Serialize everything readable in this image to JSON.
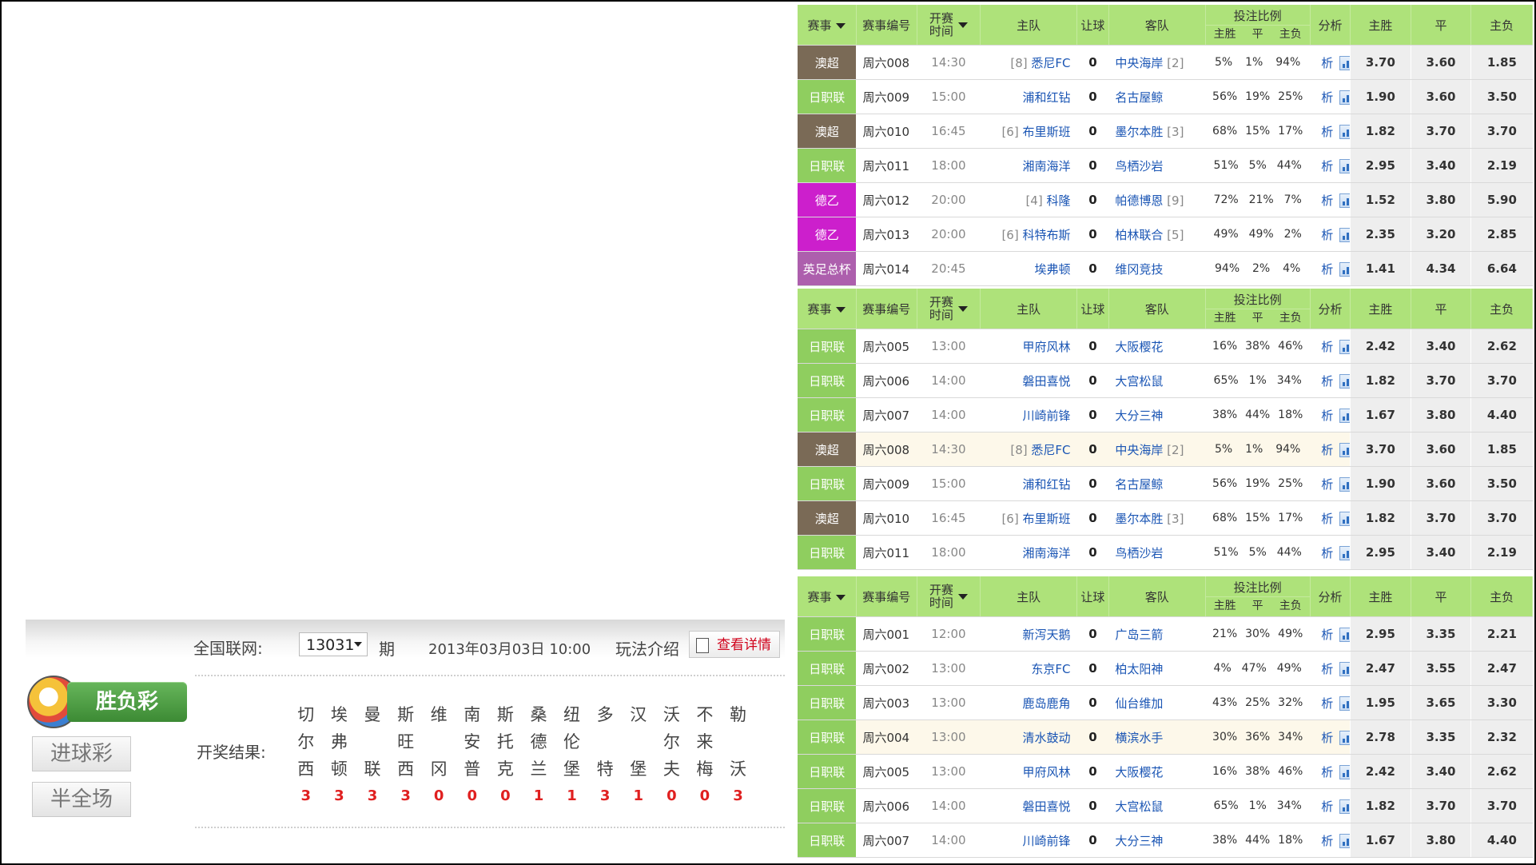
{
  "table_headers": {
    "league": "赛事",
    "match_no": "赛事编号",
    "kickoff_top": "开赛",
    "kickoff_bottom": "时间",
    "home": "主队",
    "handicap": "让球",
    "away": "客队",
    "ratio": "投注比例",
    "ratio_home": "主胜",
    "ratio_draw": "平",
    "ratio_away": "主负",
    "analysis": "分析",
    "odds_home": "主胜",
    "odds_draw": "平",
    "odds_away": "主负"
  },
  "colors": {
    "澳超": "#7a6a56",
    "日职联": "#8fce5f",
    "德乙": "#cc1fcc",
    "英足总杯": "#ad5fad"
  },
  "analysis_label": "析",
  "tables": [
    {
      "rows": [
        {
          "league": "澳超",
          "no": "周六008",
          "time": "14:30",
          "home_rank": "[8]",
          "home": "悉尼FC",
          "handicap": "0",
          "away": "中央海岸",
          "away_rank": "[2]",
          "r1": "5%",
          "r2": "1%",
          "r3": "94%",
          "o1": "3.70",
          "o2": "3.60",
          "o3": "1.85"
        },
        {
          "league": "日职联",
          "no": "周六009",
          "time": "15:00",
          "home_rank": "",
          "home": "浦和红钻",
          "handicap": "0",
          "away": "名古屋鲸",
          "away_rank": "",
          "r1": "56%",
          "r2": "19%",
          "r3": "25%",
          "o1": "1.90",
          "o2": "3.60",
          "o3": "3.50"
        },
        {
          "league": "澳超",
          "no": "周六010",
          "time": "16:45",
          "home_rank": "[6]",
          "home": "布里斯班",
          "handicap": "0",
          "away": "墨尔本胜",
          "away_rank": "[3]",
          "r1": "68%",
          "r2": "15%",
          "r3": "17%",
          "o1": "1.82",
          "o2": "3.70",
          "o3": "3.70"
        },
        {
          "league": "日职联",
          "no": "周六011",
          "time": "18:00",
          "home_rank": "",
          "home": "湘南海洋",
          "handicap": "0",
          "away": "鸟栖沙岩",
          "away_rank": "",
          "r1": "51%",
          "r2": "5%",
          "r3": "44%",
          "o1": "2.95",
          "o2": "3.40",
          "o3": "2.19"
        },
        {
          "league": "德乙",
          "no": "周六012",
          "time": "20:00",
          "home_rank": "[4]",
          "home": "科隆",
          "handicap": "0",
          "away": "帕德博恩",
          "away_rank": "[9]",
          "r1": "72%",
          "r2": "21%",
          "r3": "7%",
          "o1": "1.52",
          "o2": "3.80",
          "o3": "5.90"
        },
        {
          "league": "德乙",
          "no": "周六013",
          "time": "20:00",
          "home_rank": "[6]",
          "home": "科特布斯",
          "handicap": "0",
          "away": "柏林联合",
          "away_rank": "[5]",
          "r1": "49%",
          "r2": "49%",
          "r3": "2%",
          "o1": "2.35",
          "o2": "3.20",
          "o3": "2.85"
        },
        {
          "league": "英足总杯",
          "no": "周六014",
          "time": "20:45",
          "home_rank": "",
          "home": "埃弗顿",
          "handicap": "0",
          "away": "维冈竞技",
          "away_rank": "",
          "r1": "94%",
          "r2": "2%",
          "r3": "4%",
          "o1": "1.41",
          "o2": "4.34",
          "o3": "6.64"
        }
      ]
    },
    {
      "rows": [
        {
          "league": "日职联",
          "no": "周六005",
          "time": "13:00",
          "home_rank": "",
          "home": "甲府风林",
          "handicap": "0",
          "away": "大阪樱花",
          "away_rank": "",
          "r1": "16%",
          "r2": "38%",
          "r3": "46%",
          "o1": "2.42",
          "o2": "3.40",
          "o3": "2.62"
        },
        {
          "league": "日职联",
          "no": "周六006",
          "time": "14:00",
          "home_rank": "",
          "home": "磐田喜悦",
          "handicap": "0",
          "away": "大宫松鼠",
          "away_rank": "",
          "r1": "65%",
          "r2": "1%",
          "r3": "34%",
          "o1": "1.82",
          "o2": "3.70",
          "o3": "3.70"
        },
        {
          "league": "日职联",
          "no": "周六007",
          "time": "14:00",
          "home_rank": "",
          "home": "川崎前锋",
          "handicap": "0",
          "away": "大分三神",
          "away_rank": "",
          "r1": "38%",
          "r2": "44%",
          "r3": "18%",
          "o1": "1.67",
          "o2": "3.80",
          "o3": "4.40"
        },
        {
          "league": "澳超",
          "no": "周六008",
          "time": "14:30",
          "home_rank": "[8]",
          "home": "悉尼FC",
          "handicap": "0",
          "away": "中央海岸",
          "away_rank": "[2]",
          "r1": "5%",
          "r2": "1%",
          "r3": "94%",
          "o1": "3.70",
          "o2": "3.60",
          "o3": "1.85",
          "hl": true
        },
        {
          "league": "日职联",
          "no": "周六009",
          "time": "15:00",
          "home_rank": "",
          "home": "浦和红钻",
          "handicap": "0",
          "away": "名古屋鲸",
          "away_rank": "",
          "r1": "56%",
          "r2": "19%",
          "r3": "25%",
          "o1": "1.90",
          "o2": "3.60",
          "o3": "3.50"
        },
        {
          "league": "澳超",
          "no": "周六010",
          "time": "16:45",
          "home_rank": "[6]",
          "home": "布里斯班",
          "handicap": "0",
          "away": "墨尔本胜",
          "away_rank": "[3]",
          "r1": "68%",
          "r2": "15%",
          "r3": "17%",
          "o1": "1.82",
          "o2": "3.70",
          "o3": "3.70"
        },
        {
          "league": "日职联",
          "no": "周六011",
          "time": "18:00",
          "home_rank": "",
          "home": "湘南海洋",
          "handicap": "0",
          "away": "鸟栖沙岩",
          "away_rank": "",
          "r1": "51%",
          "r2": "5%",
          "r3": "44%",
          "o1": "2.95",
          "o2": "3.40",
          "o3": "2.19"
        }
      ]
    },
    {
      "rows": [
        {
          "league": "日职联",
          "no": "周六001",
          "time": "12:00",
          "home_rank": "",
          "home": "新泻天鹅",
          "handicap": "0",
          "away": "广岛三箭",
          "away_rank": "",
          "r1": "21%",
          "r2": "30%",
          "r3": "49%",
          "o1": "2.95",
          "o2": "3.35",
          "o3": "2.21"
        },
        {
          "league": "日职联",
          "no": "周六002",
          "time": "13:00",
          "home_rank": "",
          "home": "东京FC",
          "handicap": "0",
          "away": "柏太阳神",
          "away_rank": "",
          "r1": "4%",
          "r2": "47%",
          "r3": "49%",
          "o1": "2.47",
          "o2": "3.55",
          "o3": "2.47"
        },
        {
          "league": "日职联",
          "no": "周六003",
          "time": "13:00",
          "home_rank": "",
          "home": "鹿岛鹿角",
          "handicap": "0",
          "away": "仙台维加",
          "away_rank": "",
          "r1": "43%",
          "r2": "25%",
          "r3": "32%",
          "o1": "1.95",
          "o2": "3.65",
          "o3": "3.30"
        },
        {
          "league": "日职联",
          "no": "周六004",
          "time": "13:00",
          "home_rank": "",
          "home": "清水鼓动",
          "handicap": "0",
          "away": "横滨水手",
          "away_rank": "",
          "r1": "30%",
          "r2": "36%",
          "r3": "34%",
          "o1": "2.78",
          "o2": "3.35",
          "o3": "2.32",
          "hl": true
        },
        {
          "league": "日职联",
          "no": "周六005",
          "time": "13:00",
          "home_rank": "",
          "home": "甲府风林",
          "handicap": "0",
          "away": "大阪樱花",
          "away_rank": "",
          "r1": "16%",
          "r2": "38%",
          "r3": "46%",
          "o1": "2.42",
          "o2": "3.40",
          "o3": "2.62"
        },
        {
          "league": "日职联",
          "no": "周六006",
          "time": "14:00",
          "home_rank": "",
          "home": "磐田喜悦",
          "handicap": "0",
          "away": "大宫松鼠",
          "away_rank": "",
          "r1": "65%",
          "r2": "1%",
          "r3": "34%",
          "o1": "1.82",
          "o2": "3.70",
          "o3": "3.70"
        },
        {
          "league": "日职联",
          "no": "周六007",
          "time": "14:00",
          "home_rank": "",
          "home": "川崎前锋",
          "handicap": "0",
          "away": "大分三神",
          "away_rank": "",
          "r1": "38%",
          "r2": "44%",
          "r3": "18%",
          "o1": "1.67",
          "o2": "3.80",
          "o3": "4.40"
        }
      ]
    }
  ],
  "lottery": {
    "logo_label": "胜负彩",
    "btn_goals": "进球彩",
    "btn_halffull": "半全场",
    "network_label": "全国联网:",
    "issue": "13031",
    "issue_suffix": "期",
    "datetime": "2013年03月03日 10:00",
    "rules_label": "玩法介绍",
    "detail_label": "查看详情",
    "result_label": "开奖结果:",
    "teams": [
      {
        "lines": [
          "切",
          "尔",
          "西"
        ],
        "score": "3"
      },
      {
        "lines": [
          "埃",
          "弗",
          "顿"
        ],
        "score": "3"
      },
      {
        "lines": [
          "曼",
          "",
          "联"
        ],
        "score": "3"
      },
      {
        "lines": [
          "斯",
          "旺",
          "西"
        ],
        "score": "3"
      },
      {
        "lines": [
          "维",
          "",
          "冈"
        ],
        "score": "0"
      },
      {
        "lines": [
          "南",
          "安",
          "普"
        ],
        "score": "0"
      },
      {
        "lines": [
          "斯",
          "托",
          "克"
        ],
        "score": "0"
      },
      {
        "lines": [
          "桑",
          "德",
          "兰"
        ],
        "score": "1"
      },
      {
        "lines": [
          "纽",
          "伦",
          "堡"
        ],
        "score": "1"
      },
      {
        "lines": [
          "多",
          "",
          "特"
        ],
        "score": "3"
      },
      {
        "lines": [
          "汉",
          "",
          "堡"
        ],
        "score": "1"
      },
      {
        "lines": [
          "沃",
          "尔",
          "夫"
        ],
        "score": "0"
      },
      {
        "lines": [
          "不",
          "来",
          "梅"
        ],
        "score": "0"
      },
      {
        "lines": [
          "勒",
          "",
          "沃"
        ],
        "score": "3"
      }
    ]
  }
}
